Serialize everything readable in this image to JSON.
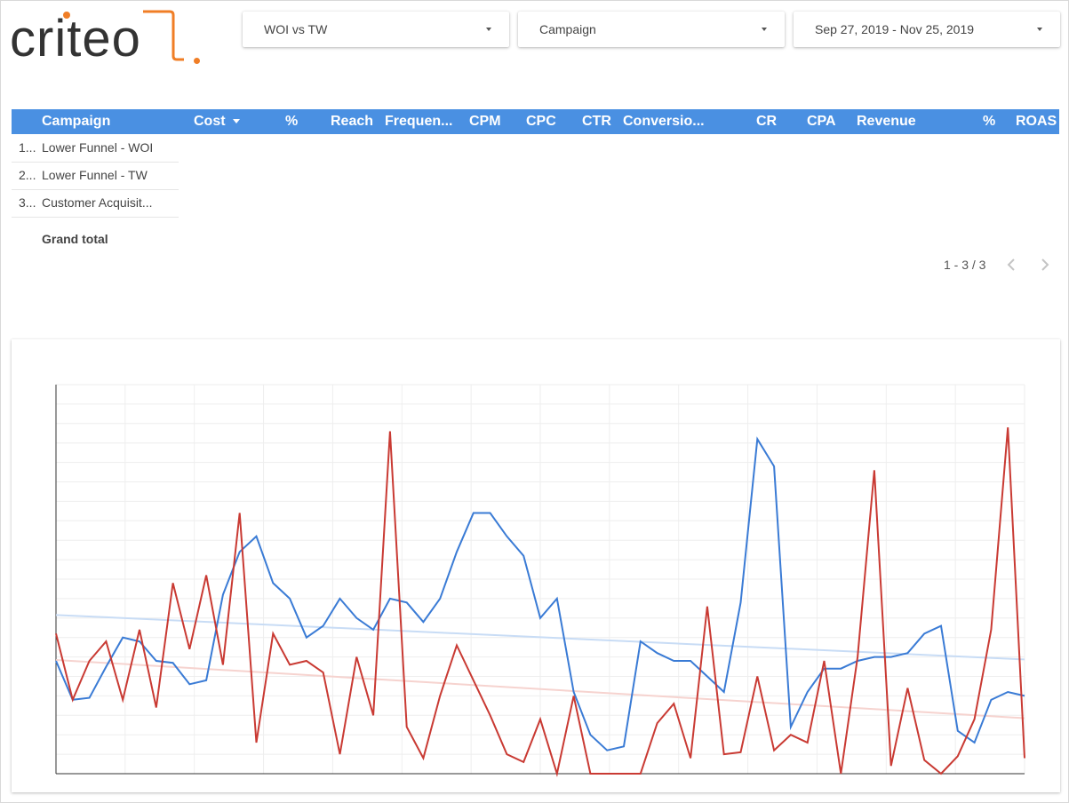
{
  "brand": {
    "logo_text": "criteo",
    "accent_color": "#f07e26",
    "logo_text_color": "#333333"
  },
  "filters": [
    {
      "label": "WOI vs TW",
      "icon": "chevron-down-icon"
    },
    {
      "label": "Campaign",
      "icon": "chevron-down-icon"
    },
    {
      "label": "Sep 27, 2019 - Nov 25, 2019",
      "icon": "chevron-down-icon"
    }
  ],
  "table": {
    "header_color": "#4a90e2",
    "columns": [
      "Campaign",
      "Cost",
      "%",
      "Reach",
      "Frequen...",
      "CPM",
      "CPC",
      "CTR",
      "Conversio...",
      "CR",
      "CPA",
      "Revenue",
      "%",
      "ROAS"
    ],
    "sorted_column": "Cost",
    "rows": [
      {
        "index": "1...",
        "campaign": "Lower Funnel - WOI"
      },
      {
        "index": "2...",
        "campaign": "Lower Funnel - TW"
      },
      {
        "index": "3...",
        "campaign": "Customer Acquisit..."
      }
    ],
    "grand_total_label": "Grand total",
    "pagination": "1 - 3 / 3"
  },
  "chart_data": {
    "type": "line",
    "title": "",
    "xlabel": "",
    "ylabel": "",
    "ylim": [
      0,
      10
    ],
    "grid": true,
    "legend": "none",
    "trendlines": true,
    "series": [
      {
        "color": "#3a7bd5",
        "trend_color": "#c8dcf5",
        "values": [
          2.9,
          1.9,
          1.95,
          2.75,
          3.5,
          3.4,
          2.9,
          2.85,
          2.3,
          2.4,
          4.6,
          5.7,
          6.1,
          4.9,
          4.5,
          3.5,
          3.8,
          4.5,
          4.0,
          3.7,
          4.5,
          4.4,
          3.9,
          4.5,
          5.7,
          6.7,
          6.7,
          6.1,
          5.6,
          4.0,
          4.5,
          2.1,
          1.0,
          0.6,
          0.7,
          3.4,
          3.1,
          2.9,
          2.9,
          2.5,
          2.1,
          4.4,
          8.6,
          7.9,
          1.2,
          2.1,
          2.7,
          2.7,
          2.9,
          3.0,
          3.0,
          3.1,
          3.6,
          3.8,
          1.1,
          0.8,
          1.9,
          2.1,
          2.0
        ]
      },
      {
        "color": "#c93a33",
        "trend_color": "#f6d3cf",
        "values": [
          3.6,
          1.9,
          2.9,
          3.4,
          1.9,
          3.7,
          1.7,
          4.9,
          3.2,
          5.1,
          2.8,
          6.7,
          0.8,
          3.6,
          2.8,
          2.9,
          2.6,
          0.5,
          3.0,
          1.5,
          8.8,
          1.2,
          0.4,
          2.0,
          3.3,
          2.4,
          1.5,
          0.5,
          0.3,
          1.4,
          0.0,
          2.0,
          0.0,
          0.0,
          0.0,
          0.0,
          1.3,
          1.8,
          0.4,
          4.3,
          0.5,
          0.55,
          2.5,
          0.6,
          1.0,
          0.8,
          2.9,
          0.0,
          3.0,
          7.8,
          0.2,
          2.2,
          0.35,
          0.0,
          0.45,
          1.4,
          3.7,
          8.9,
          0.4
        ]
      }
    ]
  }
}
